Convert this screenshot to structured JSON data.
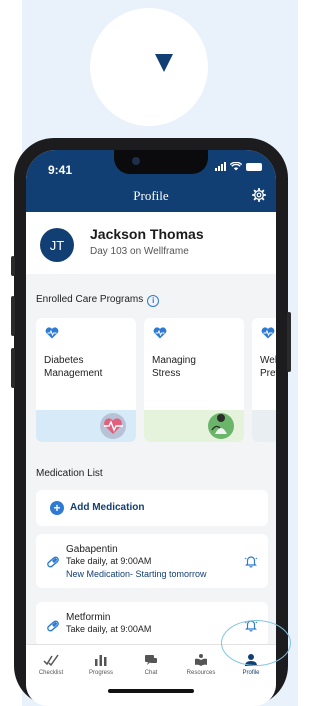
{
  "status_bar": {
    "time": "9:41"
  },
  "header": {
    "title": "Profile",
    "settings_icon": "gear-icon"
  },
  "user": {
    "initials": "JT",
    "name": "Jackson Thomas",
    "subtitle": "Day 103 on Wellframe"
  },
  "programs": {
    "heading": "Enrolled Care Programs",
    "items": [
      {
        "label_line1": "Diabetes",
        "label_line2": "Management",
        "icon": "heart-pulse-icon",
        "accent": "#d6ebf7"
      },
      {
        "label_line1": "Managing",
        "label_line2": "Stress",
        "icon": "heart-pulse-icon",
        "accent": "#e6f3dc"
      },
      {
        "label_line1": "Wel",
        "label_line2": "Prev",
        "icon": "heart-pulse-icon",
        "accent": "#e8eef2"
      }
    ]
  },
  "medications": {
    "heading": "Medication List",
    "add_label": "Add Medication",
    "items": [
      {
        "name": "Gabapentin",
        "schedule": "Take daily, at 9:00AM",
        "note": "New Medication- Starting tomorrow"
      },
      {
        "name": "Metformin",
        "schedule": "Take daily, at 9:00AM",
        "note": ""
      }
    ]
  },
  "tabs": [
    {
      "label": "Checklist",
      "icon": "checklist-icon"
    },
    {
      "label": "Progress",
      "icon": "bar-chart-icon"
    },
    {
      "label": "Chat",
      "icon": "chat-icon"
    },
    {
      "label": "Resources",
      "icon": "resources-icon"
    },
    {
      "label": "Profile",
      "icon": "person-icon",
      "active": true
    }
  ],
  "colors": {
    "brand": "#123f73",
    "accent": "#2f7bd3",
    "background": "#e9f1fa",
    "highlight_ring": "#7fc4df"
  }
}
